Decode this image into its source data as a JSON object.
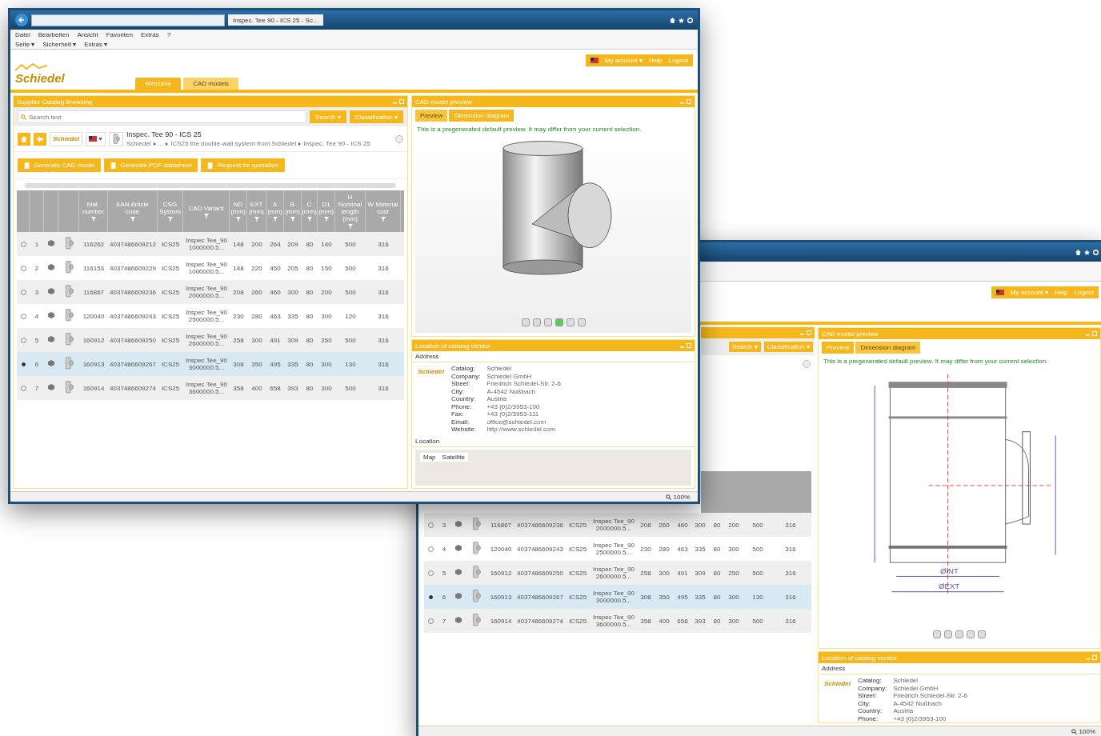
{
  "front_window": {
    "browser_tab": "Inspec. Tee 90 - ICS 25 - Sc...",
    "menu": [
      "Datei",
      "Bearbeiten",
      "Ansicht",
      "Favoriten",
      "Extras",
      "?"
    ],
    "command_bar": [
      "Seite ▾",
      "Sicherheit ▾",
      "Extras ▾"
    ],
    "logo": "Schiedel",
    "user_bar": [
      "My account ▾",
      "Help",
      "Logout"
    ],
    "tabs": [
      {
        "label": "Welcome",
        "selected": false
      },
      {
        "label": "CAD models",
        "selected": true
      }
    ],
    "catalog_panel": {
      "title": "Supplier Catalog Browsing",
      "search": {
        "placeholder": "Search text"
      },
      "search_button": "Search ▾",
      "classification_button": "Classification ▾",
      "catalog_logo": "Schiedel",
      "product_title": "Inspec. Tee 90 - ICS 25",
      "breadcrumb": [
        "Schiedel",
        "...",
        "ICS25 the double-wall system from Schiedel",
        "Inspec. Tee 90 - ICS 25"
      ],
      "actions": [
        "Generate CAD model",
        "Generate PDF datasheet",
        "Request for quotation"
      ],
      "table": {
        "columns": [
          "Mat. number",
          "EAN Article code",
          "CSG System",
          "CAD Variant",
          "ND (mm)",
          "EXT (mm)",
          "A (mm)",
          "B (mm)",
          "C (mm)",
          "D1 (mm)",
          "H Nominal length (mm)",
          "W Material cost"
        ],
        "rows": [
          {
            "selected": false,
            "number": "1",
            "cells": [
              "116262",
              "4037486609212",
              "ICS25",
              "Inspec Tee_90 1000000.5...",
              "148",
              "200",
              "264",
              "209",
              "80",
              "140",
              "500",
              "316"
            ]
          },
          {
            "selected": false,
            "number": "2",
            "cells": [
              "116153",
              "4037486609229",
              "ICS25",
              "Inspec Tee_90 1000000.5...",
              "148",
              "220",
              "450",
              "205",
              "80",
              "150",
              "500",
              "316"
            ]
          },
          {
            "selected": false,
            "number": "3",
            "cells": [
              "116867",
              "4037486609236",
              "ICS25",
              "Inspec Tee_90 2000000.5...",
              "208",
              "260",
              "460",
              "300",
              "80",
              "200",
              "500",
              "316"
            ]
          },
          {
            "selected": false,
            "number": "4",
            "cells": [
              "120040",
              "4037486609243",
              "ICS25",
              "Inspec Tee_90 2500000.5...",
              "230",
              "280",
              "463",
              "335",
              "80",
              "300",
              "120",
              "316"
            ]
          },
          {
            "selected": false,
            "number": "5",
            "cells": [
              "160912",
              "4037486609250",
              "ICS25",
              "Inspec Tee_90 2600000.5...",
              "258",
              "300",
              "491",
              "309",
              "80",
              "250",
              "500",
              "316"
            ]
          },
          {
            "selected": true,
            "number": "6",
            "cells": [
              "160913",
              "4037486609267",
              "ICS25",
              "Inspec Tee_90 3000000.5...",
              "308",
              "350",
              "495",
              "335",
              "80",
              "300",
              "130",
              "316"
            ]
          },
          {
            "selected": false,
            "number": "7",
            "cells": [
              "160914",
              "4037486609274",
              "ICS25",
              "Inspec Tee_90 3600000.5...",
              "358",
              "400",
              "658",
              "393",
              "80",
              "300",
              "500",
              "316"
            ]
          }
        ]
      }
    },
    "preview_panel": {
      "title": "CAD model preview",
      "tabs": [
        {
          "label": "Preview",
          "selected": true
        },
        {
          "label": "Dimension diagram",
          "selected": false
        }
      ],
      "notice": "This is a pregenerated default preview. It may differ from your current selection."
    },
    "location_panel": {
      "title": "Location of catalog vendor",
      "address_heading": "Address",
      "logo": "Schiedel",
      "fields": [
        {
          "label": "Catalog:",
          "value": "Schiedel"
        },
        {
          "label": "Company:",
          "value": "Schiedel GmbH"
        },
        {
          "label": "Street:",
          "value": "Friedrich Schiedel-Str. 2-6"
        },
        {
          "label": "City:",
          "value": "A-4542 Nußbach"
        },
        {
          "label": "Country:",
          "value": "Austria"
        },
        {
          "label": "Phone:",
          "value": "+43 (0)2/3953-100"
        },
        {
          "label": "Fax:",
          "value": "+43 (0)2/3953-111"
        },
        {
          "label": "Email:",
          "value": "office@schiedel.com"
        },
        {
          "label": "Website:",
          "value": "http://www.schiedel.com"
        }
      ],
      "location_heading": "Location",
      "map_tabs": [
        "Map",
        "Satellite"
      ]
    },
    "zoom": "100%"
  },
  "back_window": {
    "user_bar": [
      "My account ▾",
      "Help",
      "Logout"
    ],
    "catalog_panel": {
      "search_button": "Search ▾",
      "classification_button": "Classification ▾",
      "rows": [
        {
          "selected": false,
          "number": "3",
          "cells": [
            "116867",
            "4037486609236",
            "ICS25",
            "Inspec Tee_90 2000000.5...",
            "208",
            "260",
            "460",
            "300",
            "80",
            "200",
            "500",
            "316"
          ]
        },
        {
          "selected": false,
          "number": "4",
          "cells": [
            "120040",
            "4037486609243",
            "ICS25",
            "Inspec Tee_90 2500000.5...",
            "230",
            "280",
            "463",
            "335",
            "80",
            "300",
            "500",
            "316"
          ]
        },
        {
          "selected": false,
          "number": "5",
          "cells": [
            "160912",
            "4037486609250",
            "ICS25",
            "Inspec Tee_90 2600000.5...",
            "258",
            "300",
            "491",
            "309",
            "80",
            "250",
            "500",
            "316"
          ]
        },
        {
          "selected": true,
          "number": "6",
          "cells": [
            "160913",
            "4037486609267",
            "ICS25",
            "Inspec Tee_90 3000000.5...",
            "308",
            "350",
            "495",
            "335",
            "80",
            "300",
            "130",
            "316"
          ]
        },
        {
          "selected": false,
          "number": "7",
          "cells": [
            "160914",
            "4037486609274",
            "ICS25",
            "Inspec Tee_90 3600000.5...",
            "358",
            "400",
            "658",
            "393",
            "80",
            "300",
            "500",
            "316"
          ]
        }
      ]
    },
    "preview_panel": {
      "title": "CAD model preview",
      "tabs": [
        {
          "label": "Preview",
          "selected": false
        },
        {
          "label": "Dimension diagram",
          "selected": true
        }
      ],
      "notice": "This is a pregenerated default preview. It may differ from your current selection.",
      "diagram_labels": [
        "ØINT",
        "ØEXT"
      ]
    },
    "location_panel": {
      "title": "Location of catalog vendor",
      "address_heading": "Address",
      "logo": "Schiedel",
      "fields": [
        {
          "label": "Catalog:",
          "value": "Schiedel"
        },
        {
          "label": "Company:",
          "value": "Schiedel GmbH"
        },
        {
          "label": "Street:",
          "value": "Friedrich Schiedel-Str. 2-6"
        },
        {
          "label": "City:",
          "value": "A-4542 Nußbach"
        },
        {
          "label": "Country:",
          "value": "Austria"
        },
        {
          "label": "Phone:",
          "value": "+43 (0)2/3953-100"
        }
      ]
    },
    "zoom": "100%"
  }
}
